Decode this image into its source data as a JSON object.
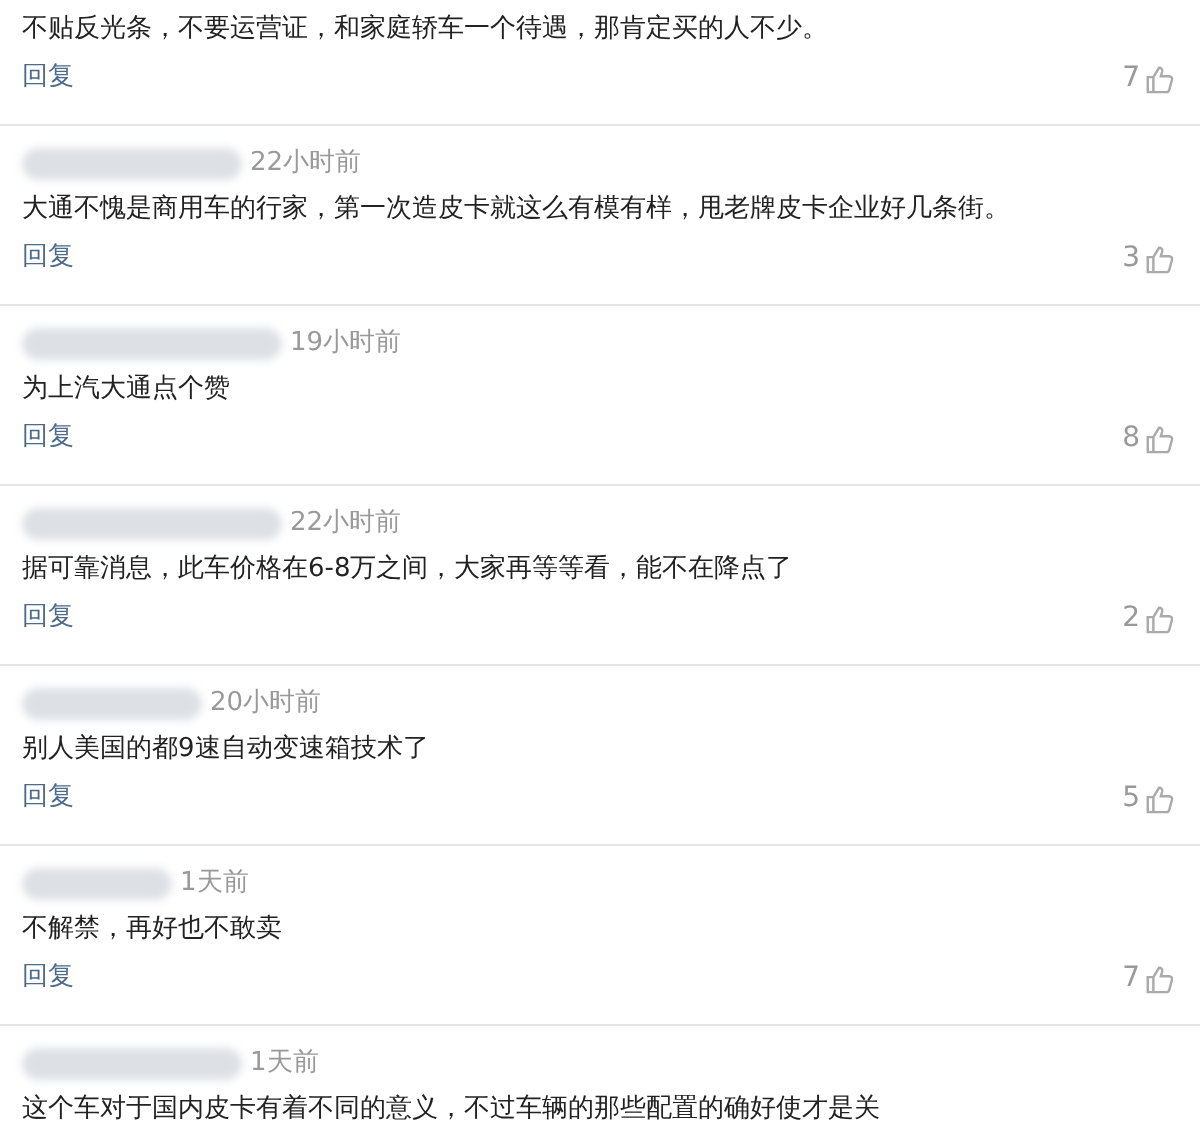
{
  "comments": [
    {
      "text": "不贴反光条，不要运营证，和家庭轿车一个待遇，那肯定买的人不少。",
      "reply": "回复",
      "likes": "7"
    },
    {
      "time": "22小时前",
      "text": "大通不愧是商用车的行家，第一次造皮卡就这么有模有样，甩老牌皮卡企业好几条街。",
      "reply": "回复",
      "likes": "3"
    },
    {
      "time": "19小时前",
      "text": "为上汽大通点个赞",
      "reply": "回复",
      "likes": "8"
    },
    {
      "time": "22小时前",
      "text": "据可靠消息，此车价格在6-8万之间，大家再等等看，能不在降点了",
      "reply": "回复",
      "likes": "2"
    },
    {
      "time": "20小时前",
      "text": "别人美国的都9速自动变速箱技术了",
      "reply": "回复",
      "likes": "5"
    },
    {
      "time": "1天前",
      "text": "不解禁，再好也不敢卖",
      "reply": "回复",
      "likes": "7"
    },
    {
      "time": "1天前",
      "text": "这个车对于国内皮卡有着不同的意义，不过车辆的那些配置的确好使才是关"
    }
  ]
}
